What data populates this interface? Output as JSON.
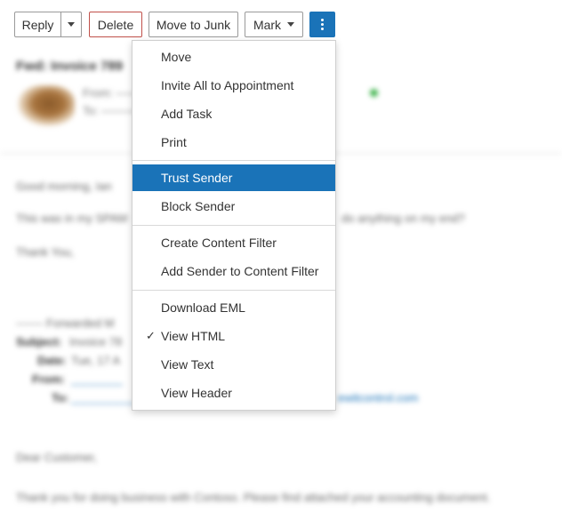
{
  "toolbar": {
    "reply_label": "Reply",
    "delete_label": "Delete",
    "junk_label": "Move to Junk",
    "mark_label": "Mark"
  },
  "menu": {
    "groups": [
      [
        "Move",
        "Invite All to Appointment",
        "Add Task",
        "Print"
      ],
      [
        "Trust Sender",
        "Block Sender"
      ],
      [
        "Create Content Filter",
        "Add Sender to Content Filter"
      ],
      [
        "Download EML",
        "View HTML",
        "View Text",
        "View Header"
      ]
    ],
    "highlighted": "Trust Sender",
    "checked": "View HTML",
    "check_mark": "✓"
  },
  "mail": {
    "subject": "Fwd: Invoice 789",
    "greeting": "Good morning, Ian",
    "body_line": "This was in my SPAM",
    "body_line_end": "do anything on my end?",
    "thanks": "Thank You,",
    "forwarded": "------- Forwarded M",
    "fwd_subject_label": "Subject:",
    "fwd_subject": "Invoice 78",
    "fwd_date_label": "Date:",
    "fwd_date": "Tue, 17 A",
    "fwd_from_label": "From:",
    "fwd_to_label": "To:",
    "fwd_to_link": "ewitcontrol.com",
    "dear": "Dear Customer,",
    "thank_you_line": "Thank you for doing business with Contoso. Please find attached your accounting document."
  },
  "colors": {
    "accent": "#1a73b8",
    "delete_border": "#c0504a",
    "status_online": "#3cb34a"
  }
}
